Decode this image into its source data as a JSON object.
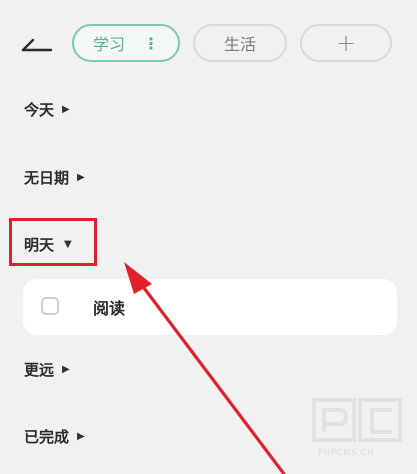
{
  "header": {
    "back_icon": "collapse-icon",
    "tabs": [
      {
        "label": "学习",
        "more": "⋮",
        "active": true
      },
      {
        "label": "生活",
        "active": false
      }
    ],
    "add_label": "+"
  },
  "sections": [
    {
      "label": "今天",
      "expanded": false
    },
    {
      "label": "无日期",
      "expanded": false
    },
    {
      "label": "明天",
      "expanded": true
    },
    {
      "label": "更远",
      "expanded": false
    },
    {
      "label": "已完成",
      "expanded": false
    }
  ],
  "tasks": [
    {
      "title": "阅读",
      "checked": false
    }
  ],
  "annotation": {
    "color": "#e0202a"
  },
  "watermark": {
    "text": "PHPCMS.CN"
  }
}
